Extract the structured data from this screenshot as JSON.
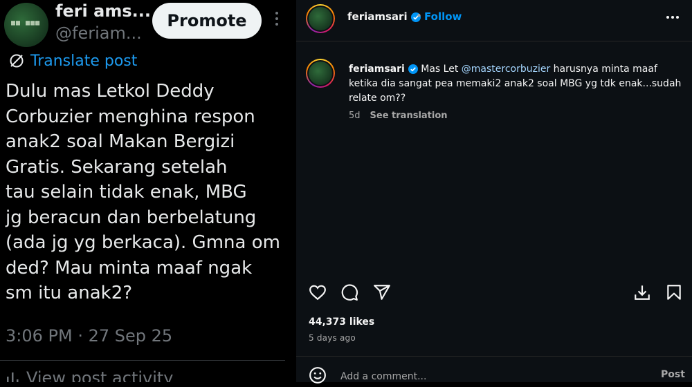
{
  "colors": {
    "x_background": "#000000",
    "x_link_blue": "#1d9bf0",
    "x_secondary": "#71767b",
    "ig_background": "#0c1014",
    "ig_follow_blue": "#0095f6",
    "ig_verified_blue": "#0095f6"
  },
  "x_post": {
    "author_name": "feri ams...",
    "author_handle": "@feriam...",
    "promote_label": "Promote",
    "more_icon": "more-vertical-icon",
    "translate_label": "Translate post",
    "body_lines": [
      "Dulu mas Letkol Deddy",
      "Corbuzier menghina respon",
      "anak2 soal Makan Bergizi",
      "Gratis. Sekarang setelah",
      "tau selain tidak enak, MBG",
      "jg beracun dan berbelatung",
      "(ada jg yg berkaca). Gmna om",
      "ded? Mau minta maaf ngak",
      "sm itu anak2?"
    ],
    "timestamp": "3:06 PM · 27 Sep 25",
    "view_activity_label": "View post activity"
  },
  "ig_post": {
    "username": "feriamsari",
    "dot": "•",
    "follow_label": "Follow",
    "more_icon": "more-horizontal-icon",
    "caption": {
      "username": "feriamsari",
      "text_before": "Mas Let ",
      "mention": "@mastercorbuzier",
      "text_after": " harusnya minta maaf ketika dia sangat pea memaki2 anak2 soal MBG yg tdk enak...sudah relate om??"
    },
    "age_short": "5d",
    "see_translation": "See translation",
    "likes": "44,373 likes",
    "posted_ago": "5 days ago",
    "comment_placeholder": "Add a comment...",
    "post_label": "Post",
    "icons": [
      "heart-icon",
      "comment-icon",
      "share-icon",
      "download-icon",
      "bookmark-icon",
      "emoji-icon"
    ]
  }
}
